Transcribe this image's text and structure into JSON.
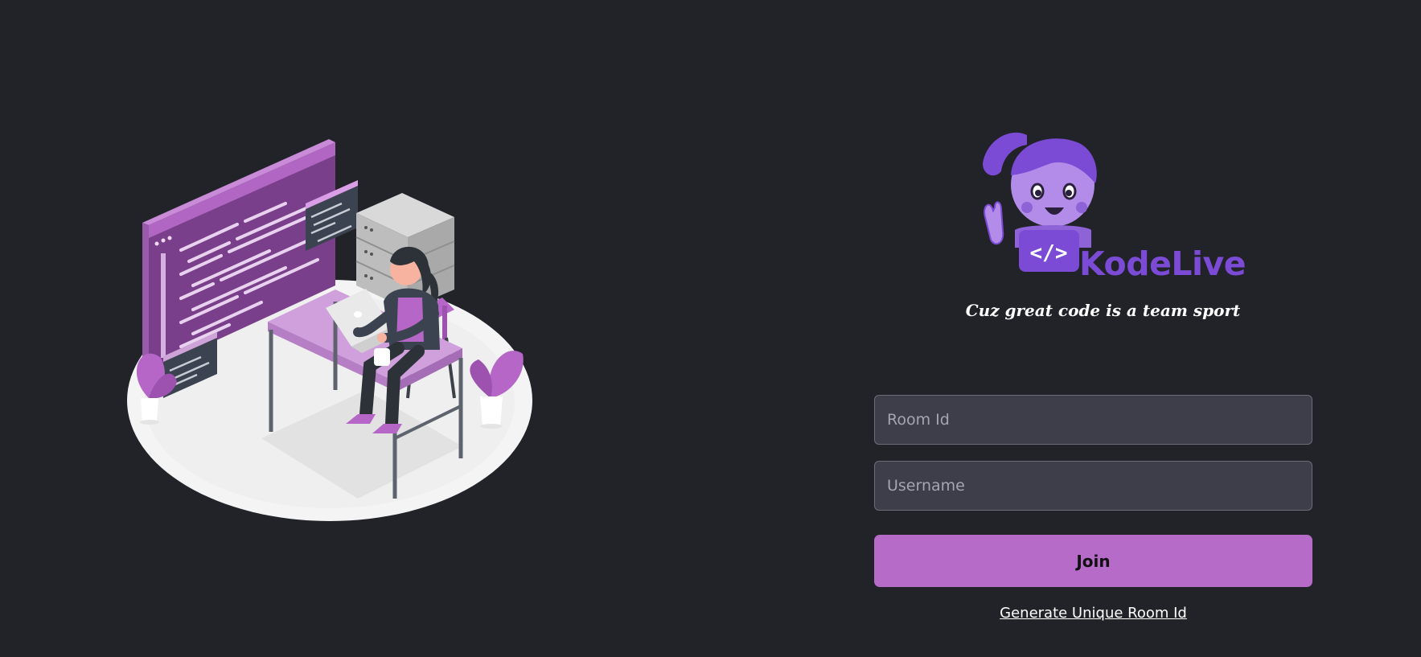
{
  "brand": {
    "name": "KodeLive",
    "tagline": "Cuz great code is a team sport",
    "accent": "#7b4bd6",
    "logo_icon": "coding-girl-mascot-icon"
  },
  "illustration": {
    "icon": "developer-at-desk-illustration"
  },
  "form": {
    "room_placeholder": "Room Id",
    "username_placeholder": "Username",
    "join_label": "Join",
    "generate_label": "Generate Unique Room Id",
    "button_color": "#b66bc8"
  },
  "theme": {
    "background": "#212328",
    "input_bg": "#3d3e49"
  }
}
